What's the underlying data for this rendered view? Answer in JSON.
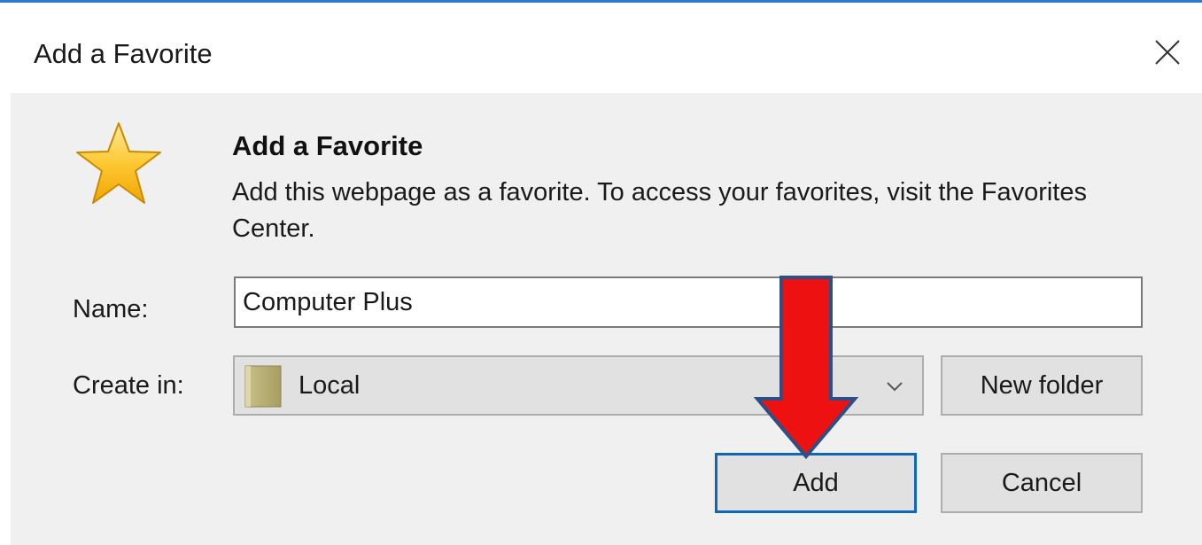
{
  "window": {
    "title": "Add a Favorite",
    "accent_color": "#2b79d0"
  },
  "header": {
    "icon": "star-icon",
    "heading": "Add a Favorite",
    "description": "Add this webpage as a favorite. To access your favorites, visit the Favorites Center."
  },
  "form": {
    "name_label": "Name:",
    "name_value": "Computer Plus",
    "create_in_label": "Create in:",
    "create_in_value": "Local",
    "create_in_icon": "folder-icon"
  },
  "buttons": {
    "new_folder": "New folder",
    "add": "Add",
    "cancel": "Cancel"
  },
  "annotation": {
    "type": "red-arrow-icon",
    "color": "#ee1111",
    "points_to": "add-button"
  }
}
